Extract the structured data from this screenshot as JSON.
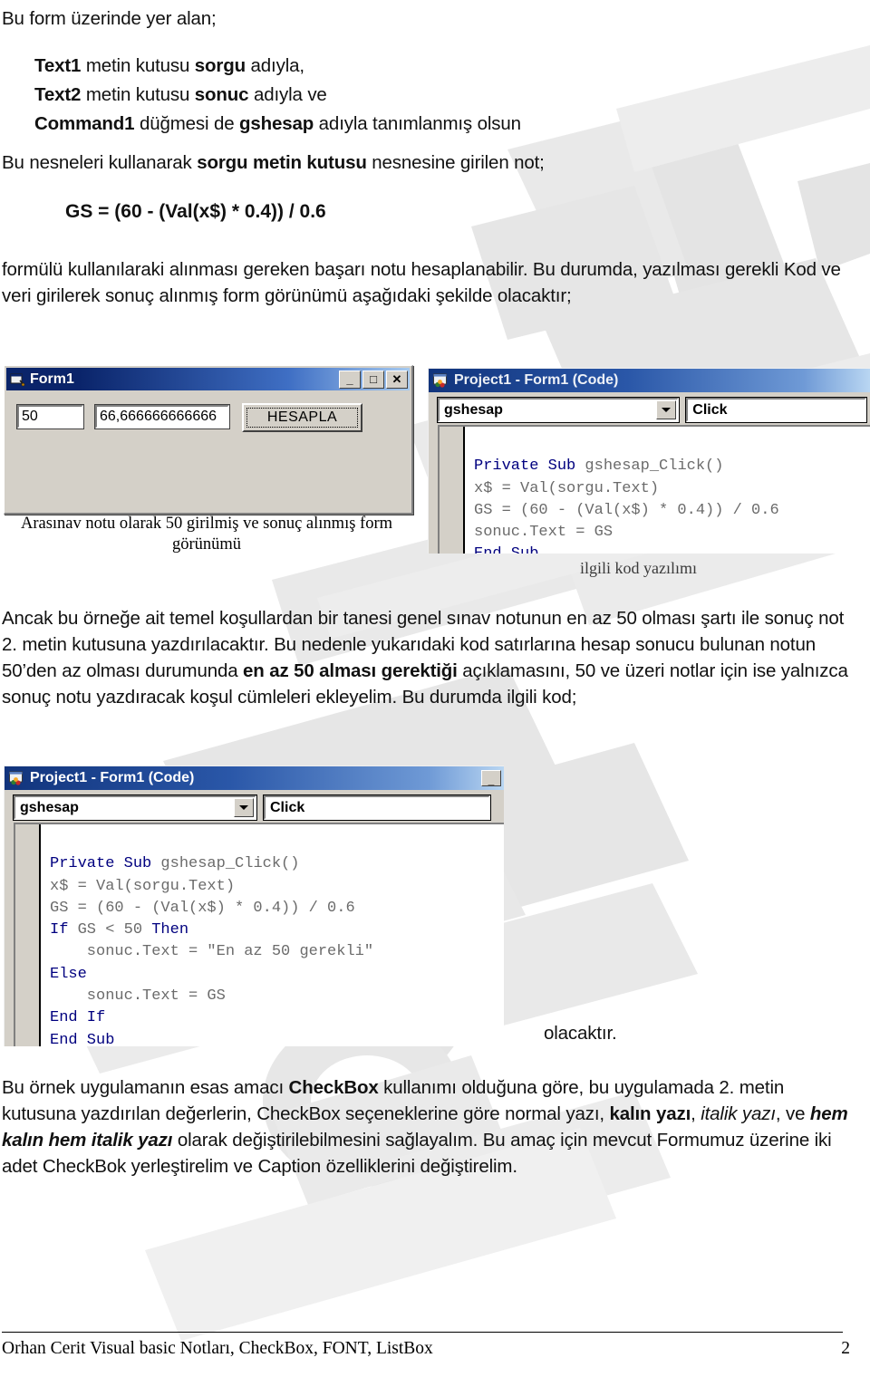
{
  "document": {
    "intro_line": "Bu form üzerinde yer alan;",
    "bullets": [
      {
        "bold1": "Text1",
        "mid": " metin kutusu ",
        "bold2": "sorgu",
        "tail": " adıyla,"
      },
      {
        "bold1": "Text2",
        "mid": " metin kutusu ",
        "bold2": "sonuc",
        "tail": " adıyla ve"
      },
      {
        "bold1": "Command1",
        "mid": " düğmesi de ",
        "bold2": "gshesap",
        "tail": " adıyla tanımlanmış olsun"
      }
    ],
    "objects_line_pre": "Bu nesneleri kullanarak ",
    "objects_line_bold": "sorgu metin kutusu",
    "objects_line_post": " nesnesine girilen not;",
    "formula": "GS = (60 - (Val(x$) * 0.4)) / 0.6",
    "para_formula": "formülü kullanılaraki alınması gereken başarı notu hesaplanabilir. Bu durumda, yazılması gerekli Kod ve veri girilerek sonuç alınmış form görünümü aşağıdaki şekilde olacaktır;",
    "para_mid_1": "Ancak bu örneğe ait temel koşullardan bir tanesi genel sınav notunun en az 50 olması şartı ile sonuç not 2. metin kutusuna yazdırılacaktır. Bu nedenle yukarıdaki kod satırlarına hesap sonucu bulunan notun 50’den az olması durumunda ",
    "para_mid_bold": "en az 50 alması gerektiği",
    "para_mid_2": " açıklamasını, 50 ve üzeri notlar için ise yalnızca sonuç notu yazdıracak koşul cümleleri ekleyelim. Bu durumda ilgili kod;",
    "olacaktir": "olacaktır.",
    "para_bottom_1": "Bu örnek uygulamanın esas amacı ",
    "para_bottom_checkbox": "CheckBox",
    "para_bottom_2": " kullanımı olduğuna göre, bu uygulamada 2. metin kutusuna yazdırılan değerlerin, CheckBox seçeneklerine göre normal yazı, ",
    "para_bottom_bold": "kalın yazı",
    "para_bottom_3": ", ",
    "para_bottom_italic": "italik yazı",
    "para_bottom_4": ", ve ",
    "para_bottom_bolditalic": "hem kalın hem italik yazı",
    "para_bottom_5": " olarak değiştirilebilmesini sağlayalım. Bu amaç için mevcut Formumuz üzerine iki adet CheckBok yerleştirelim ve Caption özelliklerini değiştirelim."
  },
  "form_window": {
    "title": "Form1",
    "icon": "vb-form-icon",
    "titlebar_buttons": [
      {
        "name": "minimize",
        "glyph": "_"
      },
      {
        "name": "maximize",
        "glyph": "□"
      },
      {
        "name": "close",
        "glyph": "✕"
      }
    ],
    "sorgu_value": "50",
    "sonuc_value": "66,666666666666",
    "button_label": "HESAPLA",
    "caption": "Arasınav notu olarak 50 girilmiş ve sonuç alınmış form görünümü"
  },
  "code_window_1": {
    "title": "Project1 - Form1 (Code)",
    "icon": "vb-code-icon",
    "object_combo": "gshesap",
    "event_combo": "Click",
    "code_lines": [
      {
        "kw": "Private Sub ",
        "rest": "gshesap_Click()"
      },
      {
        "kw": "",
        "rest": "x$ = Val(sorgu.Text)"
      },
      {
        "kw": "",
        "rest": "GS = (60 - (Val(x$) * 0.4)) / 0.6"
      },
      {
        "kw": "",
        "rest": "sonuc.Text = GS"
      },
      {
        "kw": "End Sub",
        "rest": ""
      }
    ],
    "caption": "ilgili kod yazılımı"
  },
  "code_window_2": {
    "title": "Project1 - Form1 (Code)",
    "icon": "vb-code-icon",
    "object_combo": "gshesap",
    "event_combo": "Click",
    "minimize_glyph": "_",
    "code_lines": [
      {
        "kw": "Private Sub ",
        "rest": "gshesap_Click()"
      },
      {
        "kw": "",
        "rest": "x$ = Val(sorgu.Text)"
      },
      {
        "kw": "",
        "rest": "GS = (60 - (Val(x$) * 0.4)) / 0.6"
      },
      {
        "kw": "If ",
        "rest": "GS < 50 ",
        "kw2": "Then"
      },
      {
        "kw": "",
        "rest": "    sonuc.Text = \"En az 50 gerekli\""
      },
      {
        "kw": "Else",
        "rest": ""
      },
      {
        "kw": "",
        "rest": "    sonuc.Text = GS"
      },
      {
        "kw": "End If",
        "rest": ""
      },
      {
        "kw": "End Sub",
        "rest": ""
      }
    ]
  },
  "footer": {
    "text": "Orhan Cerit Visual basic Notları, CheckBox, FONT, ListBox",
    "page_number": "2"
  },
  "colors": {
    "titlebar_start": "#0a246a",
    "titlebar_end": "#a6caf0",
    "window_face": "#d4d0c8",
    "code_keyword": "#00007f",
    "code_text": "#6b6b6b",
    "watermark": "#e2e2e2"
  }
}
